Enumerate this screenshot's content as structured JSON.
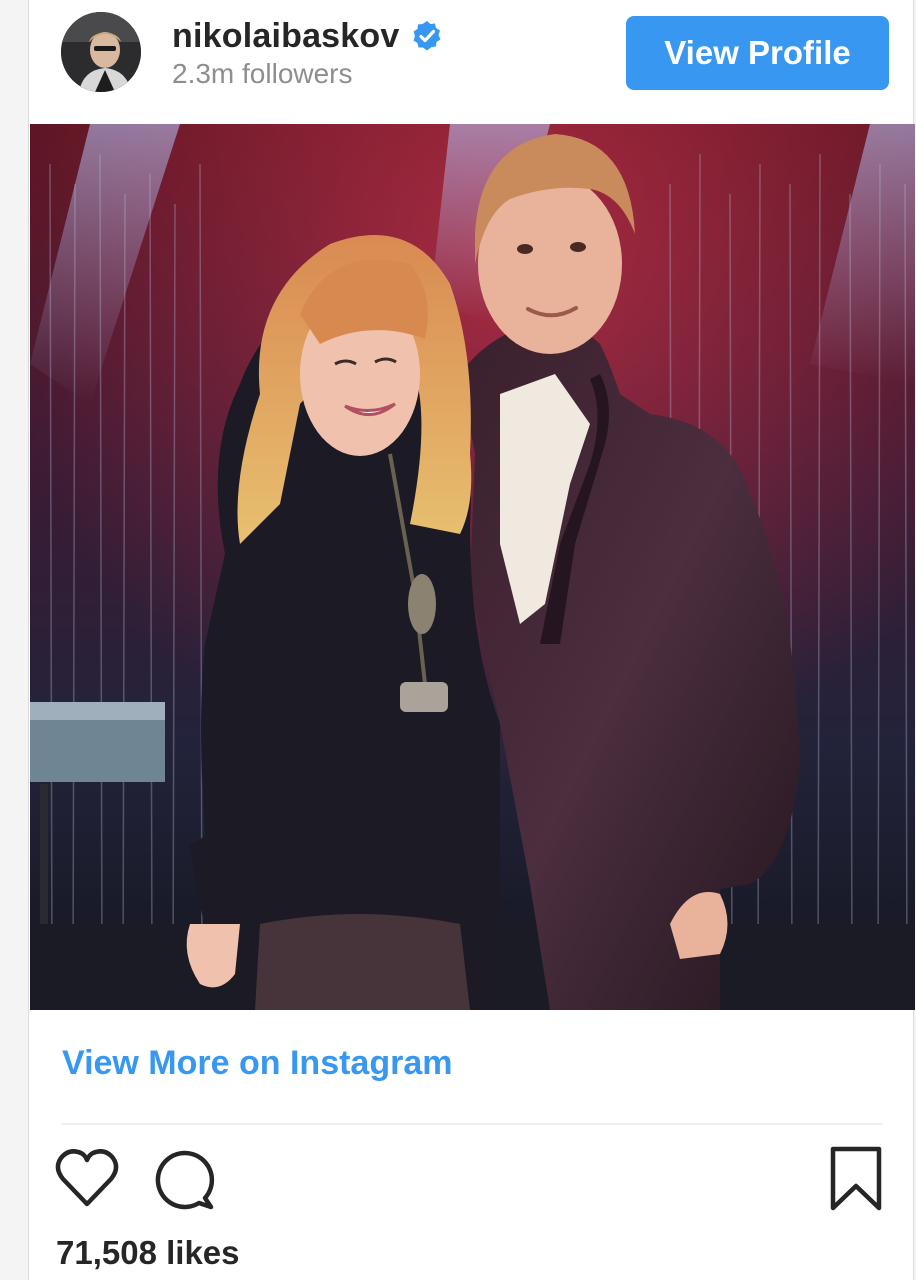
{
  "header": {
    "username": "nikolaibaskov",
    "followers": "2.3m followers",
    "view_profile_label": "View Profile",
    "verified_icon": "verified-badge-icon"
  },
  "post": {
    "photo_description_icon": "post-photo",
    "view_more_label": "View More on Instagram",
    "likes": "71,508 likes"
  },
  "actions": {
    "like_icon": "heart-icon",
    "comment_icon": "comment-icon",
    "save_icon": "bookmark-icon"
  },
  "colors": {
    "accent": "#3897f0",
    "text_primary": "#262626",
    "text_secondary": "#8e8e8e"
  }
}
